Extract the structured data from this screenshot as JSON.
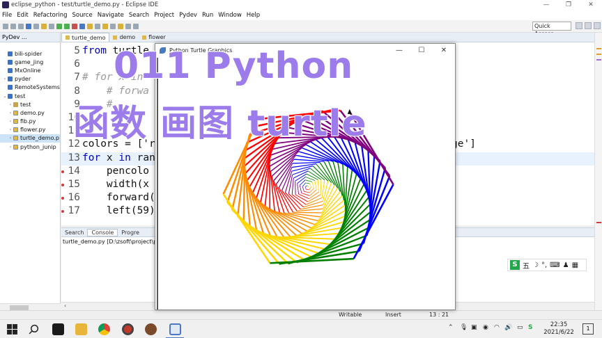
{
  "window": {
    "title": "eclipse_python - test/turtle_demo.py - Eclipse IDE",
    "minimize": "—",
    "maximize": "❐",
    "close": "✕"
  },
  "menu": [
    "File",
    "Edit",
    "Refactoring",
    "Source",
    "Navigate",
    "Search",
    "Project",
    "Pydev",
    "Run",
    "Window",
    "Help"
  ],
  "toolbar": {
    "quick_access": "Quick Access"
  },
  "package_explorer": {
    "tab": "PyDev ...",
    "items": [
      {
        "label": "bili-spider",
        "indent": 0,
        "twisty": "",
        "icon": "proj"
      },
      {
        "label": "game_jing",
        "indent": 0,
        "twisty": "",
        "icon": "proj"
      },
      {
        "label": "MxOnline",
        "indent": 0,
        "twisty": "",
        "icon": "proj"
      },
      {
        "label": "pyder",
        "indent": 0,
        "twisty": "›",
        "icon": "proj"
      },
      {
        "label": "RemoteSystems",
        "indent": 0,
        "twisty": "",
        "icon": "proj"
      },
      {
        "label": "test",
        "indent": 0,
        "twisty": "⌄",
        "icon": "proj"
      },
      {
        "label": "test",
        "indent": 1,
        "twisty": "›",
        "icon": "pkgf"
      },
      {
        "label": "demo.py",
        "indent": 1,
        "twisty": "›",
        "icon": "py"
      },
      {
        "label": "fib.py",
        "indent": 1,
        "twisty": "›",
        "icon": "py"
      },
      {
        "label": "flower.py",
        "indent": 1,
        "twisty": "›",
        "icon": "py"
      },
      {
        "label": "turtle_demo.p",
        "indent": 1,
        "twisty": "›",
        "icon": "py",
        "selected": true
      },
      {
        "label": "python_junip",
        "indent": 1,
        "twisty": "›",
        "icon": "py"
      }
    ]
  },
  "editor": {
    "tabs": [
      "turtle_demo",
      "demo",
      "flower"
    ],
    "lines": [
      {
        "num": "5",
        "parts": [
          {
            "t": "from",
            "c": "kw"
          },
          {
            "t": " turtle",
            "c": ""
          }
        ]
      },
      {
        "num": "6",
        "parts": []
      },
      {
        "num": "7",
        "parts": [
          {
            "t": "# for x in",
            "c": "cm"
          }
        ]
      },
      {
        "num": "8",
        "parts": [
          {
            "t": "    # forwa",
            "c": "cm"
          }
        ]
      },
      {
        "num": "9",
        "parts": [
          {
            "t": "    # ",
            "c": "cm"
          }
        ]
      },
      {
        "num": "10",
        "parts": []
      },
      {
        "num": "11",
        "parts": []
      },
      {
        "num": "12",
        "parts": [
          {
            "t": "colors = ['r",
            "c": ""
          }
        ]
      },
      {
        "num": "13",
        "parts": [
          {
            "t": "for",
            "c": "kw"
          },
          {
            "t": " x ",
            "c": ""
          },
          {
            "t": "in",
            "c": "kw"
          },
          {
            "t": " ran",
            "c": ""
          }
        ],
        "highlight": true
      },
      {
        "num": "14",
        "parts": [
          {
            "t": "    pencolo",
            "c": ""
          }
        ],
        "marker": true
      },
      {
        "num": "15",
        "parts": [
          {
            "t": "    width(x",
            "c": ""
          }
        ],
        "marker": true
      },
      {
        "num": "16",
        "parts": [
          {
            "t": "    forward(",
            "c": ""
          }
        ],
        "marker": true
      },
      {
        "num": "17",
        "parts": [
          {
            "t": "    left(59)",
            "c": ""
          }
        ],
        "marker": true
      }
    ],
    "tail_line12": "ge']"
  },
  "console": {
    "tabs": [
      "Search",
      "Console",
      "Progre"
    ],
    "text": "turtle_demo.py [D:\\zsoft\\project\\p"
  },
  "status": {
    "mode": "Writable",
    "insert": "Insert",
    "position": "13 : 21"
  },
  "turtle_window": {
    "title": "Python Turtle Graphics",
    "minimize": "—",
    "maximize": "☐",
    "close": "✕"
  },
  "overlay": {
    "line1": "011 Python",
    "line2": "函数 画图 turtle"
  },
  "ime": {
    "badge": "S",
    "items": [
      "五",
      "☽",
      "°,",
      "⌨",
      "♟",
      "▦"
    ]
  },
  "taskbar": {
    "time": "22:35",
    "date": "2021/6/22",
    "notify": "1"
  },
  "colors": {
    "overlay": "#9b7cea",
    "rainbow": [
      "#ff0000",
      "#ff8c00",
      "#ffd700",
      "#008000",
      "#0000ff",
      "#800080"
    ]
  }
}
